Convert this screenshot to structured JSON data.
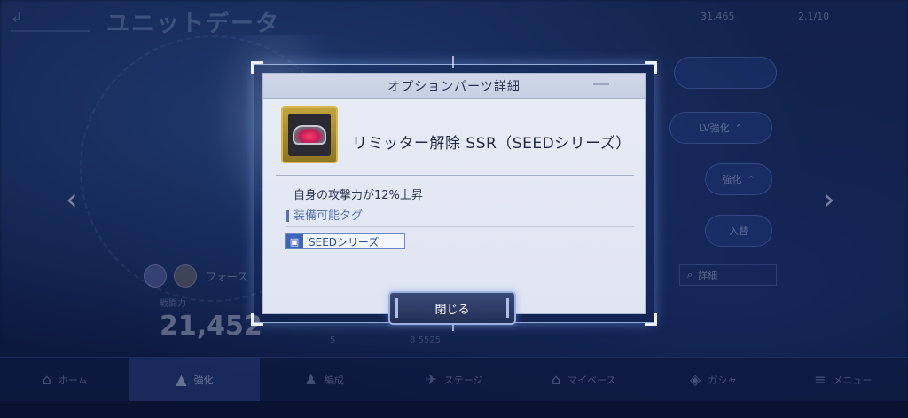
{
  "background": {
    "screen_title": "ユニットデータ",
    "currency_1": "31,465",
    "currency_2": "2,1/10",
    "pill_lv_label": "LV強化",
    "pill_kyoka_label": "強化",
    "pill_toggle_label": "入替",
    "force_label": "フォース",
    "search_box_label": "詳細",
    "power_label": "戦闘力",
    "power_value": "21,452",
    "stat_1": "5",
    "stat_2": "8 5525",
    "nav": {
      "home": "ホーム",
      "kyoka": "強化",
      "hensei": "編成",
      "stage": "ステージ",
      "mybase": "マイベース",
      "gacha": "ガシャ",
      "menu": "メニュー"
    }
  },
  "modal": {
    "title": "オプションパーツ詳細",
    "item_name": "リミッター解除 SSR（SEEDシリーズ）",
    "effect": "自身の攻撃力が12%上昇",
    "tag_heading": "装備可能タグ",
    "tag": "SEEDシリーズ",
    "close_label": "閉じる"
  }
}
